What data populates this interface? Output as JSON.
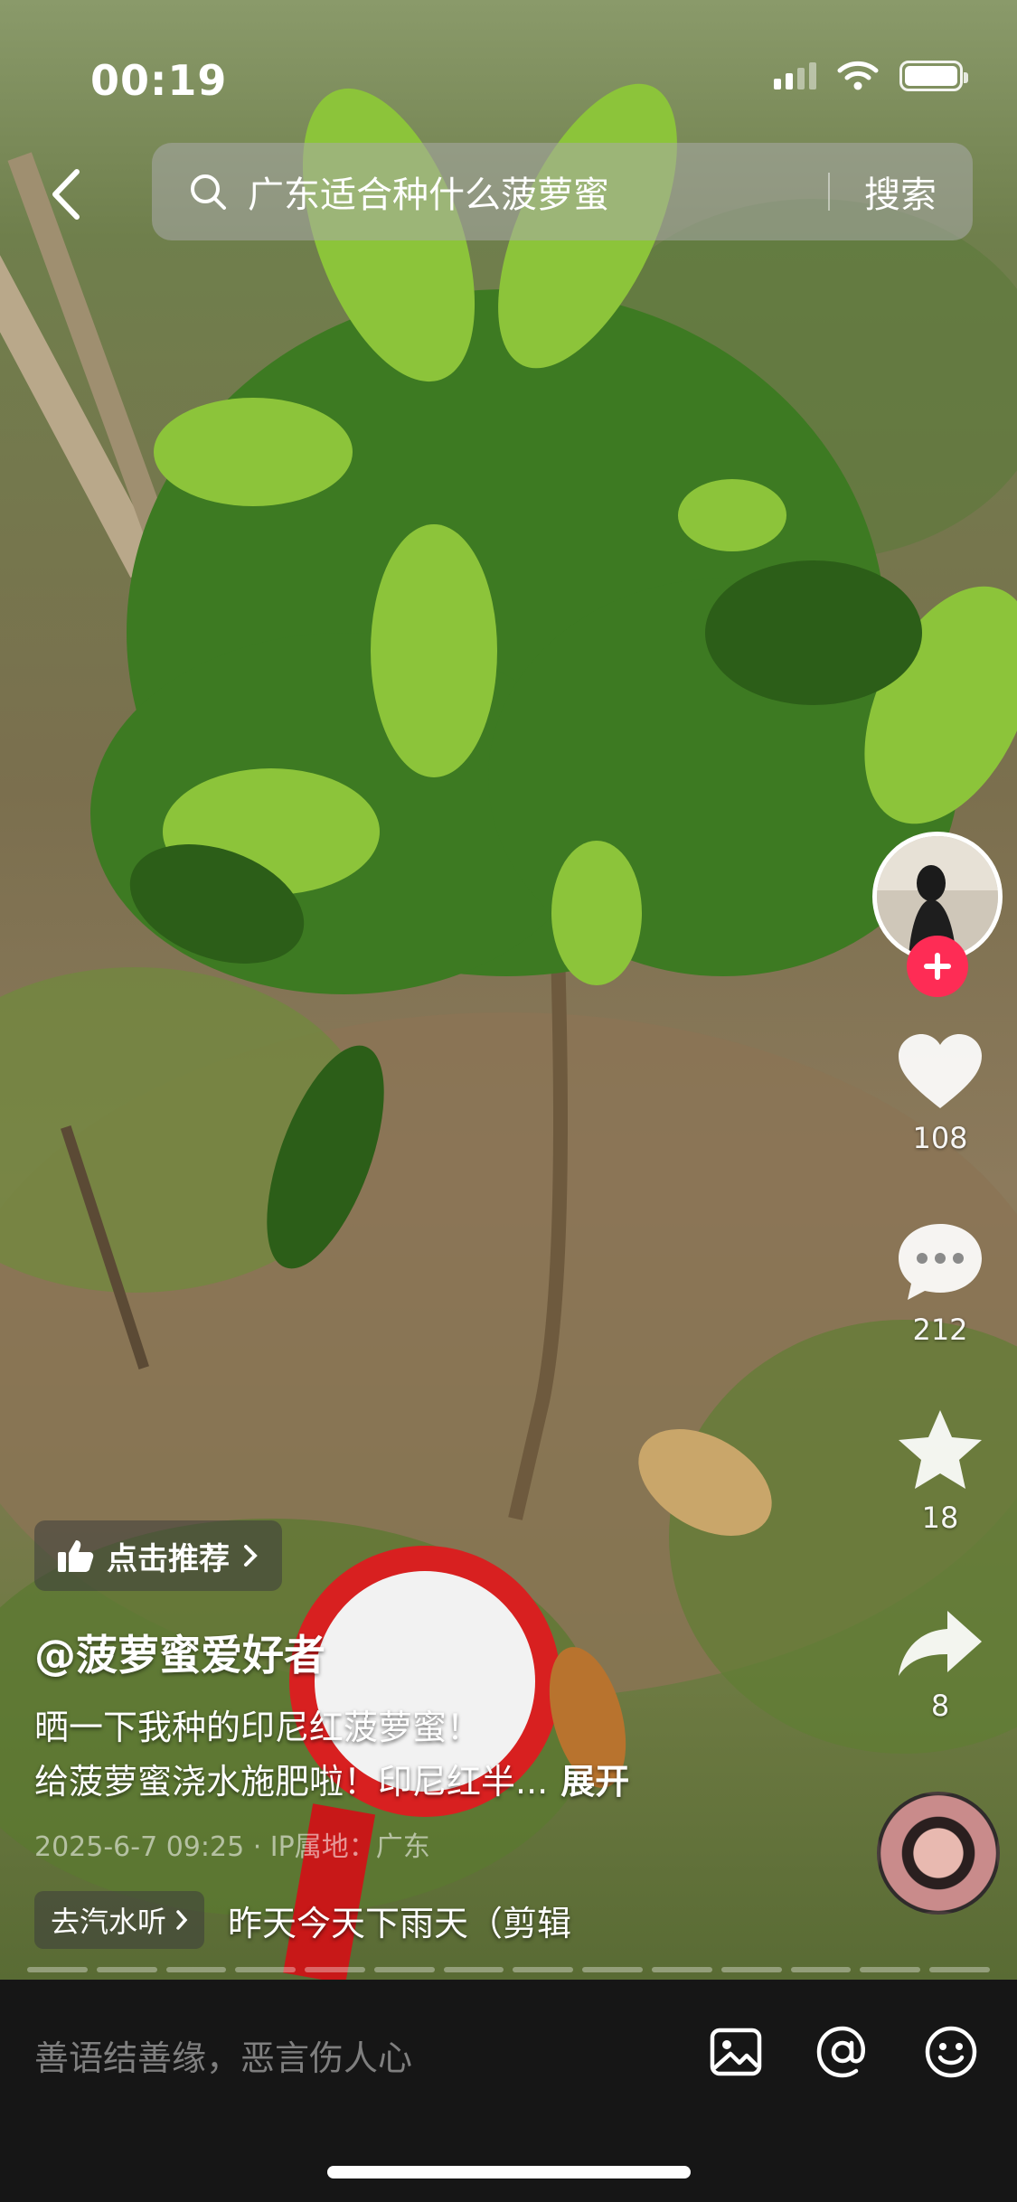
{
  "status_bar": {
    "time": "00:19",
    "icons": [
      "cellular-signal-icon",
      "wifi-icon",
      "battery-icon"
    ]
  },
  "search": {
    "query": "广东适合种什么菠萝蜜",
    "button_label": "搜索"
  },
  "actions": {
    "likes": "108",
    "comments": "212",
    "favorites": "18",
    "shares": "8"
  },
  "video": {
    "recommend_label": "点击推荐",
    "username": "@菠萝蜜爱好者",
    "description_line1": "晒一下我种的印尼红菠萝蜜！",
    "description_line2": "给菠萝蜜浇水施肥啦！印尼红半...",
    "expand_label": "展开",
    "meta": "2025-6-7 09:25 · IP属地：广东",
    "music_link_label": "去汽水听",
    "music_title": "昨天今天下雨天（剪辑"
  },
  "comment_bar": {
    "placeholder": "善语结善缘，恶言伤人心",
    "icons": [
      "image-icon",
      "at-mention-icon",
      "emoji-icon"
    ]
  },
  "colors": {
    "follow_accent": "#fe2c55",
    "comment_bar_bg": "#161616"
  }
}
